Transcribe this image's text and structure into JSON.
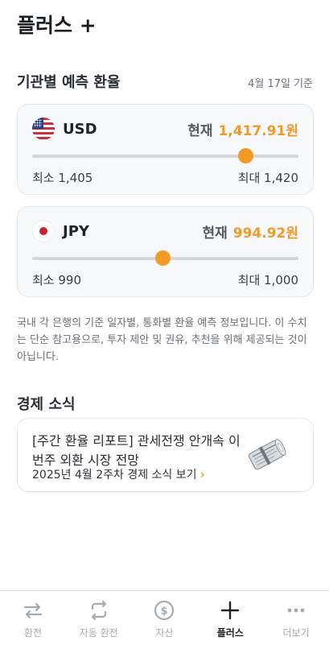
{
  "header": {
    "title": "플러스 +"
  },
  "forecast": {
    "title": "기관별 예측 환율",
    "date": "4월 17일 기준",
    "cards": [
      {
        "currency": "USD",
        "flag_icon": "us-flag-icon",
        "current_label": "현재",
        "current_value": "1,417.91원",
        "min_label": "최소 1,405",
        "max_label": "최대 1,420",
        "slider_fraction": 0.8
      },
      {
        "currency": "JPY",
        "flag_icon": "japan-flag-icon",
        "current_label": "현재",
        "current_value": "994.92원",
        "min_label": "최소 990",
        "max_label": "최대 1,000",
        "slider_fraction": 0.49
      }
    ],
    "disclaimer": "국내 각 은행의 기준 일자별, 통화별 환율 예측 정보입니다. 이 수치는 단순 참고용으로, 투자 제안 및 권유, 추천을 위해 제공되는 것이 아닙니다."
  },
  "news": {
    "section_title": "경제 소식",
    "headline": "[주간 환율 리포트] 관세전쟁 안개속 이번주 외환 시장 전망",
    "link_label": "2025년 4월 2주차 경제 소식 보기",
    "image_icon": "rolled-newspaper-icon"
  },
  "colors": {
    "accent": "#f39a25",
    "text": "#1f2328",
    "muted": "#a6abb1"
  },
  "tabbar": {
    "tabs": [
      {
        "label": "환전",
        "icon": "exchange-arrows-icon",
        "active": false
      },
      {
        "label": "자동 환전",
        "icon": "auto-exchange-icon",
        "active": false
      },
      {
        "label": "자산",
        "icon": "dollar-coin-icon",
        "active": false
      },
      {
        "label": "플러스",
        "icon": "plus-icon",
        "active": true
      },
      {
        "label": "더보기",
        "icon": "more-dots-icon",
        "active": false
      }
    ]
  }
}
